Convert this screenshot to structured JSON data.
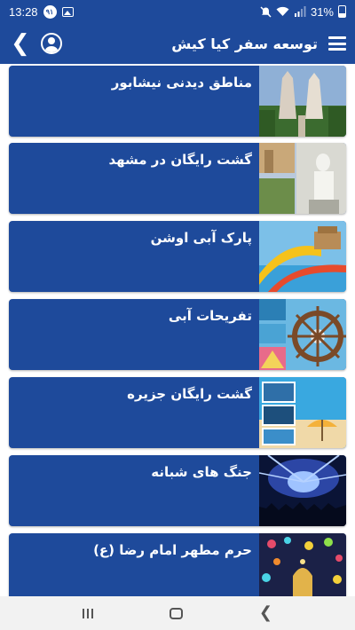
{
  "status": {
    "time": "13:28",
    "badge": "۹۱",
    "battery": "31%"
  },
  "header": {
    "title": "توسعه سفر کیا کیش"
  },
  "cards": [
    {
      "title": "مناطق دیدنی نیشابور"
    },
    {
      "title": "گشت رایگان در مشهد"
    },
    {
      "title": "پارک آبی اوشن"
    },
    {
      "title": "تفریحات آبی"
    },
    {
      "title": "گشت رایگان جزیره"
    },
    {
      "title": "جنگ های شبانه"
    },
    {
      "title": "حرم مطهر امام رضا (ع)"
    }
  ],
  "colors": {
    "primary": "#1e4a9b",
    "background": "#ffffff",
    "nav_bar": "#f2f2f2"
  }
}
